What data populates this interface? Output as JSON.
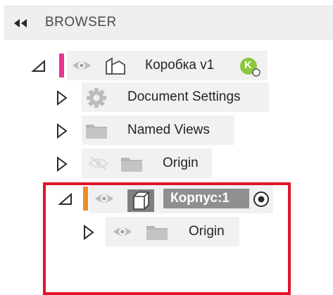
{
  "header": {
    "title": "BROWSER"
  },
  "tree": {
    "root": {
      "label": "Коробка v1",
      "badge": "K",
      "marker_color": "#e8358f"
    },
    "document_settings": {
      "label": "Document Settings"
    },
    "named_views": {
      "label": "Named Views"
    },
    "origin": {
      "label": "Origin"
    },
    "component": {
      "label": "Корпус:1",
      "marker_color": "#f08a2a"
    },
    "component_origin": {
      "label": "Origin"
    }
  },
  "colors": {
    "selection_frame": "#e0152a",
    "badge": "#8dc63f"
  }
}
